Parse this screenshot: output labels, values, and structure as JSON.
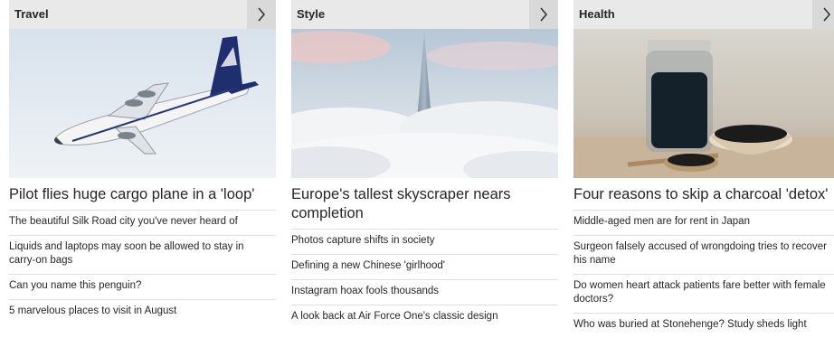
{
  "sections": [
    {
      "title": "Travel",
      "headline": "Pilot flies huge cargo plane in a 'loop'",
      "links": [
        "The beautiful Silk Road city you've never heard of",
        "Liquids and laptops may soon be allowed to stay in carry-on bags",
        "Can you name this penguin?",
        "5 marvelous places to visit in August"
      ]
    },
    {
      "title": "Style",
      "headline": "Europe's tallest skyscraper nears completion",
      "links": [
        "Photos capture shifts in society",
        "Defining a new Chinese 'girlhood'",
        "Instagram hoax fools thousands",
        "A look back at Air Force One's classic design"
      ]
    },
    {
      "title": "Health",
      "headline": "Four reasons to skip a charcoal 'detox'",
      "links": [
        "Middle-aged men are for rent in Japan",
        "Surgeon falsely accused of wrongdoing tries to recover his name",
        "Do women heart attack patients fare better with female doctors?",
        "Who was buried at Stonehenge? Study sheds light"
      ]
    }
  ],
  "icons": {
    "next": "chevron-right-icon"
  },
  "colors": {
    "header_bg": "#e9e9e9",
    "button_bg": "#d9d9d9",
    "divider": "#dedede"
  }
}
